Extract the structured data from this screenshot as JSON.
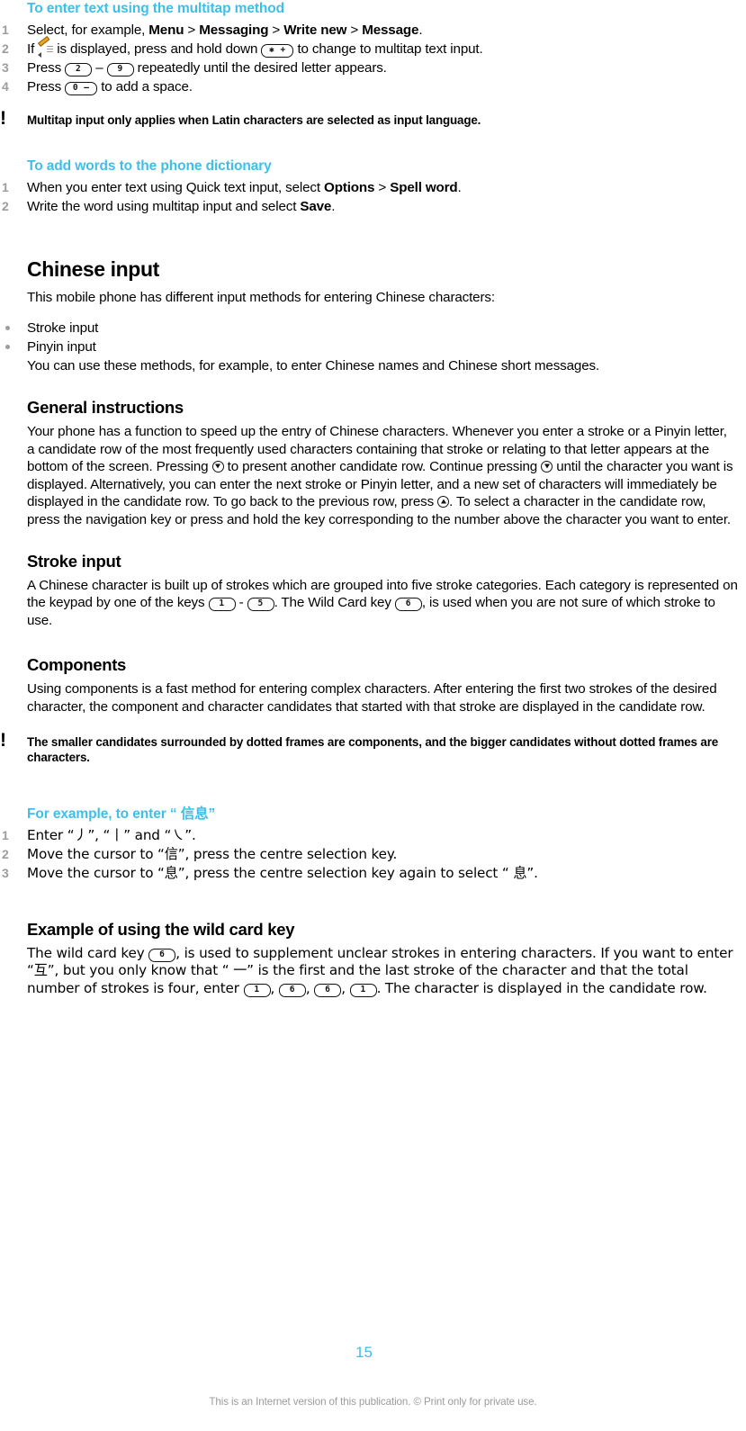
{
  "document": {
    "page_number": "15",
    "footer_note": "This is an Internet version of this publication. © Print only for private use.",
    "accent_color": "#3fbfe8",
    "number_color": "#9d9d9d"
  },
  "sections": {
    "multitap": {
      "title": "To enter text using the multitap method",
      "steps": [
        {
          "num": "1",
          "parts": [
            {
              "t": "Select, for example, ",
              "style": "normal"
            },
            {
              "t": "Menu",
              "style": "bold"
            },
            {
              "t": " > ",
              "style": "normal"
            },
            {
              "t": "Messaging",
              "style": "bold"
            },
            {
              "t": " > ",
              "style": "normal"
            },
            {
              "t": "Write new",
              "style": "bold"
            },
            {
              "t": " > ",
              "style": "normal"
            },
            {
              "t": "Message",
              "style": "bold"
            },
            {
              "t": ".",
              "style": "normal"
            }
          ]
        },
        {
          "num": "2",
          "pre": "If ",
          "icon": "pencil-icon",
          "mid": " is displayed, press and hold down ",
          "key": "✱ +",
          "post": " to change to multitap text input."
        },
        {
          "num": "3",
          "pre": "Press ",
          "key_a": "2",
          "mid": " – ",
          "key_b": "9",
          "post": " repeatedly until the desired letter appears."
        },
        {
          "num": "4",
          "pre": "Press ",
          "key": "0 ‒",
          "post": " to add a space."
        }
      ],
      "note": "Multitap input only applies when Latin characters are selected as input language."
    },
    "dictionary": {
      "title": "To add words to the phone dictionary",
      "steps": [
        {
          "num": "1",
          "parts": [
            {
              "t": "When you enter text using Quick text input, select ",
              "style": "normal"
            },
            {
              "t": "Options",
              "style": "bold"
            },
            {
              "t": " > ",
              "style": "normal"
            },
            {
              "t": "Spell word",
              "style": "bold"
            },
            {
              "t": ".",
              "style": "normal"
            }
          ]
        },
        {
          "num": "2",
          "parts": [
            {
              "t": "Write the word using multitap input and select ",
              "style": "normal"
            },
            {
              "t": "Save",
              "style": "bold"
            },
            {
              "t": ".",
              "style": "normal"
            }
          ]
        }
      ]
    },
    "chinese_input": {
      "title": "Chinese input",
      "intro": "This mobile phone has different input methods for entering Chinese characters:",
      "bullets": [
        {
          "label": "Stroke input"
        },
        {
          "label": "Pinyin input",
          "continuation": "You can use these methods, for example, to enter Chinese names and Chinese short messages."
        }
      ]
    },
    "general_instructions": {
      "title": "General instructions",
      "body_1": "Your phone has a function to speed up the entry of Chinese characters. Whenever you enter a stroke or a Pinyin letter, a candidate row of the most frequently used characters containing that stroke or relating to that letter appears at the bottom of the screen. Pressing ",
      "body_2": " to present another candidate row. Continue pressing ",
      "body_3": " until the character you want is displayed. Alternatively, you can enter the next stroke or Pinyin letter, and a new set of characters will immediately be displayed in the candidate row. To go back to the previous row, press ",
      "body_4": ". To select a character in the candidate row, press the navigation key or press and hold the key corresponding to the number above the character you want to enter."
    },
    "stroke_input": {
      "title": "Stroke input",
      "body_1": "A Chinese character is built up of strokes which are grouped into five stroke categories. Each category is represented on the keypad by one of the keys ",
      "key_a": "1",
      "body_2": " - ",
      "key_b": "5",
      "body_3": ". The Wild Card key ",
      "key_c": "6",
      "body_4": ", is used when you are not sure of which stroke to use."
    },
    "components": {
      "title": "Components",
      "body": "Using components is a fast method for entering complex characters. After entering the first two strokes of the desired character, the component and character candidates that started with that stroke are displayed in the candidate row.",
      "note": "The smaller candidates surrounded by dotted frames are components, and the bigger candidates without dotted frames are characters."
    },
    "example_enter": {
      "title_pre": "For example, to enter “ ",
      "title_cjk": "信息",
      "title_post": "”",
      "steps": [
        {
          "num": "1",
          "text": "Enter “丿”, “丨” and “㇏”."
        },
        {
          "num": "2",
          "text": "Move the cursor to “信”, press the centre selection key."
        },
        {
          "num": "3",
          "text": "Move the cursor to “息”, press the centre selection key again to select “ 息”."
        }
      ]
    },
    "wild_card": {
      "title": "Example of using the wild card key",
      "body_1": "The wild card key ",
      "key_wild": "6",
      "body_2": ", is used to supplement unclear strokes in entering characters. If you want to enter “互”, but you only know that “ 一” is the first and the last stroke of the character and that the total number of strokes is four, enter ",
      "keys_sequence": [
        "1",
        "6",
        "6",
        "1"
      ],
      "body_3": ". The character is displayed in the candidate row."
    }
  }
}
